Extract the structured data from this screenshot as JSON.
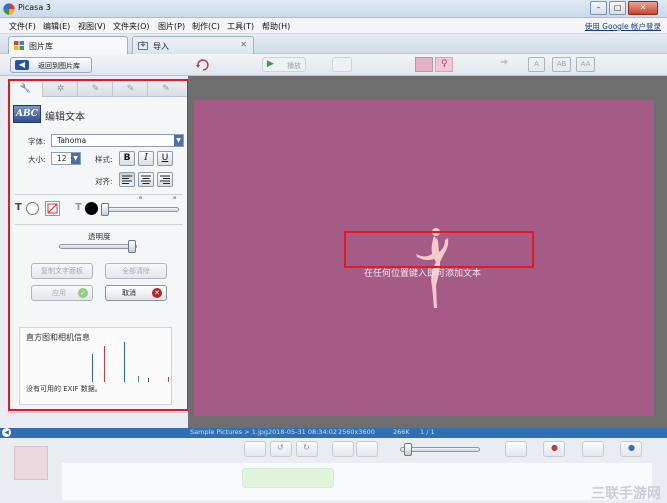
{
  "window": {
    "title": "Picasa 3"
  },
  "menu": {
    "items": [
      "文件(F)",
      "编辑(E)",
      "视图(V)",
      "文件夹(O)",
      "图片(P)",
      "制作(C)",
      "工具(T)",
      "帮助(H)"
    ],
    "sign_in": "使用 Google 帐户登录"
  },
  "tabs": [
    {
      "label": "图片库",
      "active": true
    },
    {
      "label": "导入",
      "active": false
    }
  ],
  "toolbar": {
    "back_label": "返回到图片库",
    "play_label": "播放",
    "view_labels": [
      "A",
      "AB",
      "AA"
    ]
  },
  "panel": {
    "edit_title": "编辑文本",
    "abc_icon": "ABC",
    "font_label": "字体:",
    "font_value": "Tahoma",
    "size_label": "大小:",
    "size_value": "12",
    "style_label": "样式:",
    "style_buttons": [
      "B",
      "I",
      "U"
    ],
    "align_label": "对齐:",
    "transparency_label": "透明度",
    "copy_text_label": "复制文字面板",
    "clear_all_label": "全部清除",
    "apply_label": "应用",
    "cancel_label": "取消",
    "histogram_title": "直方图和相机信息",
    "exif_text": "没有可用的 EXIF 数据。"
  },
  "canvas": {
    "overlay_text": "在任何位置键入即可添加文本",
    "background_color": "#a45c86"
  },
  "status": {
    "file": "Sample Pictures > 1.jpg",
    "date": "2018-05-31 08:34:02",
    "dimensions": "2560x3600",
    "size": "266K",
    "index": "1 / 1"
  },
  "watermark": {
    "text": "三联手游网"
  },
  "colors": {
    "highlight": "#e01b24",
    "statusbar": "#2f6fb3",
    "green": "#8fd27d"
  }
}
